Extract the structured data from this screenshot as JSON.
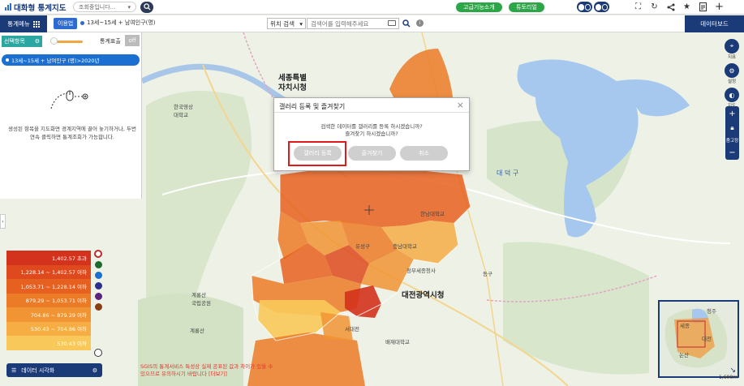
{
  "app": {
    "title": "대화형 통계지도"
  },
  "top": {
    "loading_text": "조회중입니다...",
    "advanced_btn": "고급기능소개",
    "tutorial_btn": "튜토리얼",
    "icons": [
      "fullscreen-icon",
      "refresh-icon",
      "share-icon",
      "bookmark-star-icon",
      "report-icon",
      "plus-icon"
    ]
  },
  "second": {
    "menu_label": "통계메뉴",
    "usage_label": "이용법",
    "indicator": "13세~15세 + 남여인구(명)",
    "location_select": "위치 검색",
    "search_placeholder": "검색어를 입력해주세요",
    "dashboard_label": "데이터보드"
  },
  "panel": {
    "select_area_label": "선택항목",
    "legend_toggle_label": "통계표출",
    "off_label": "off",
    "year_chip": "13세~15세 + 남여인구 (명)>2020년",
    "help_text": "생성된 항목을 지도화면 경계지역에 끌어 놓기하거나, 두번 연속 클릭하면 통계조회가 가능합니다."
  },
  "legend": {
    "rows": [
      {
        "label": "1,402.57 초과",
        "color": "#d3321c"
      },
      {
        "label": "1,228.14 ~ 1,402.57 이하",
        "color": "#de4a1d"
      },
      {
        "label": "1,053.71 ~ 1,228.14 이하",
        "color": "#e6601f"
      },
      {
        "label": "879.29 ~ 1,053.71 이하",
        "color": "#ec7b27"
      },
      {
        "label": "704.86 ~ 879.29 이하",
        "color": "#f19433"
      },
      {
        "label": "530.43 ~ 704.86 이하",
        "color": "#f5ad44"
      },
      {
        "label": "530.43 이하",
        "color": "#f8c95a"
      }
    ],
    "color_options": [
      "#c1272d",
      "#1e6b2f",
      "#1b6fd1",
      "#2b2f8f",
      "#5a2380",
      "#8a3d12"
    ]
  },
  "data_viz_label": "데이터 시각화",
  "warning": "SGIS의 통계서비스 특성상 실제 공표된 값과 차이가 있을 수 있으므로 유의하시기 바랍니다 [더보기]",
  "tools": [
    {
      "label": "지표",
      "icon": "map-pin-icon"
    },
    {
      "label": "설정",
      "icon": "settings-icon"
    },
    {
      "label": "지도",
      "icon": "map-type-icon"
    }
  ],
  "zoom": {
    "in": "+",
    "lock_label": "줌고정",
    "out": "−"
  },
  "minimap": {
    "labels": [
      "청주",
      "세종",
      "대전",
      "논산"
    ]
  },
  "scale": "1,600m",
  "map_labels": {
    "sejong": "세종특별\n자치시청",
    "daejeon": "대전광역시청",
    "deokgu": "대 덕 구",
    "dong_gu": "동구",
    "park1": "계룡산\n국립공원",
    "park2": "계룡산",
    "school1": "한국영상\n대학교",
    "school2": "충남대학교",
    "school3": "한남대학교",
    "place1": "정부세종청사",
    "place2": "배재대학교",
    "place3": "유성구",
    "place4": "서대전"
  },
  "modal": {
    "title": "갤러리 등록 및 즐겨찾기",
    "line1": "검색한 데이터를 갤러리를 등록 하시겠습니까?",
    "line2": "즐겨찾기 하시겠습니까?",
    "gallery_btn": "갤러리 등록",
    "favorite_btn": "즐겨찾기",
    "cancel_btn": "취소"
  }
}
